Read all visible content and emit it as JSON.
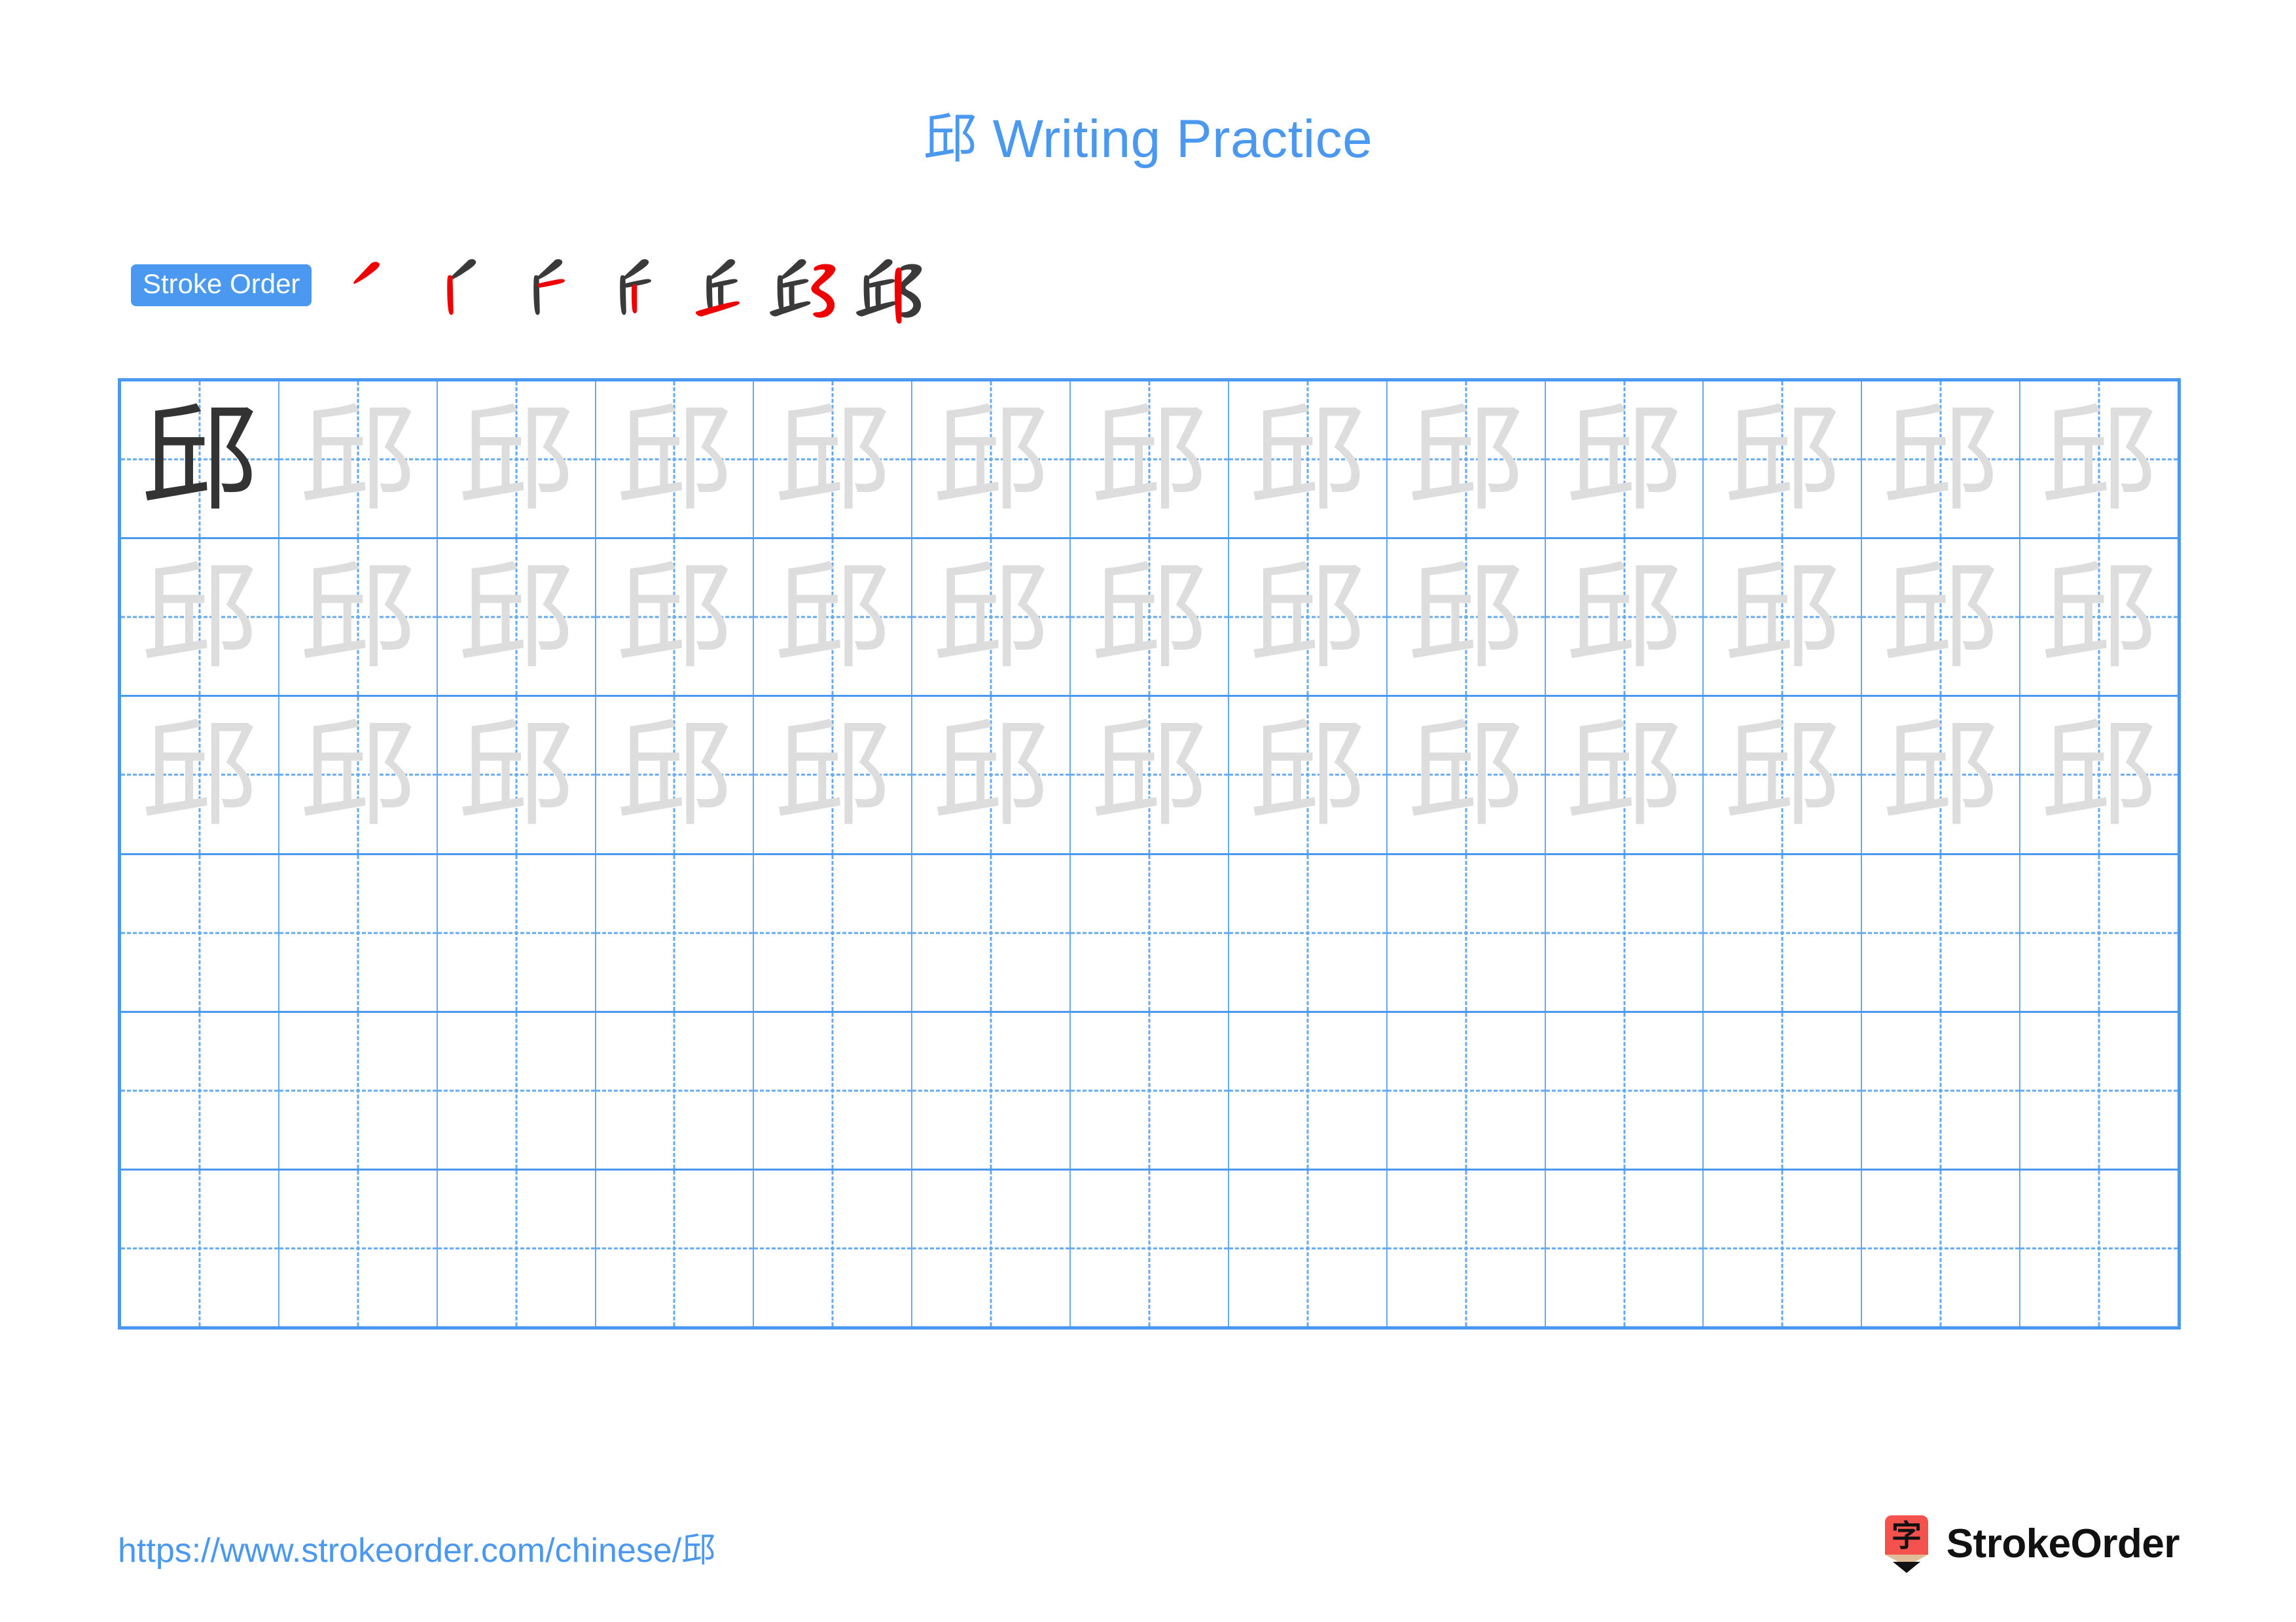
{
  "character": "邱",
  "title": "邱 Writing Practice",
  "colors": {
    "accent_blue": "#4a98f0",
    "grid_line_blue": "#64a9f2",
    "stroke_new_red": "#ee0000",
    "stroke_done_dark": "#3a3a3a",
    "trace_gray": "#dddddd",
    "solid_char": "#333333",
    "logo_red": "#f4524d",
    "logo_wood": "#e0bd96",
    "logo_tip": "#111111"
  },
  "stroke_order": {
    "badge_label": "Stroke Order",
    "step_count": 7,
    "steps": [
      {
        "index": 1,
        "name": "stroke-step-1",
        "new_stroke": "撇 (left falling)"
      },
      {
        "index": 2,
        "name": "stroke-step-2",
        "new_stroke": "竖 (vertical)"
      },
      {
        "index": 3,
        "name": "stroke-step-3",
        "new_stroke": "横 (horizontal)"
      },
      {
        "index": 4,
        "name": "stroke-step-4",
        "new_stroke": "竖 (vertical)"
      },
      {
        "index": 5,
        "name": "stroke-step-5",
        "new_stroke": "横 (bottom horizontal)"
      },
      {
        "index": 6,
        "name": "stroke-step-6",
        "new_stroke": "横折折折钩 (right ear)"
      },
      {
        "index": 7,
        "name": "stroke-step-7",
        "new_stroke": "竖 (final vertical)"
      }
    ]
  },
  "practice_grid": {
    "columns": 13,
    "rows": 6,
    "cells": [
      [
        "solid",
        "trace",
        "trace",
        "trace",
        "trace",
        "trace",
        "trace",
        "trace",
        "trace",
        "trace",
        "trace",
        "trace",
        "trace"
      ],
      [
        "trace",
        "trace",
        "trace",
        "trace",
        "trace",
        "trace",
        "trace",
        "trace",
        "trace",
        "trace",
        "trace",
        "trace",
        "trace"
      ],
      [
        "trace",
        "trace",
        "trace",
        "trace",
        "trace",
        "trace",
        "trace",
        "trace",
        "trace",
        "trace",
        "trace",
        "trace",
        "trace"
      ],
      [
        "empty",
        "empty",
        "empty",
        "empty",
        "empty",
        "empty",
        "empty",
        "empty",
        "empty",
        "empty",
        "empty",
        "empty",
        "empty"
      ],
      [
        "empty",
        "empty",
        "empty",
        "empty",
        "empty",
        "empty",
        "empty",
        "empty",
        "empty",
        "empty",
        "empty",
        "empty",
        "empty"
      ],
      [
        "empty",
        "empty",
        "empty",
        "empty",
        "empty",
        "empty",
        "empty",
        "empty",
        "empty",
        "empty",
        "empty",
        "empty",
        "empty"
      ]
    ]
  },
  "footer": {
    "url": "https://www.strokeorder.com/chinese/邱",
    "brand_name": "StrokeOrder",
    "logo_char": "字"
  }
}
